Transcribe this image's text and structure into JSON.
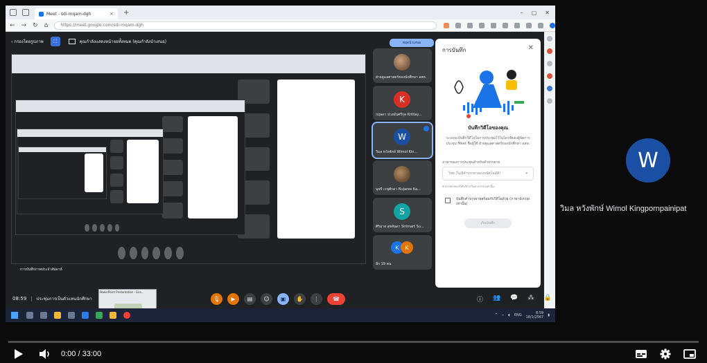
{
  "browser": {
    "tab_title": "Meet - sdi-mqam-dgh",
    "tab_close": "×",
    "new_tab": "+",
    "url": "https://meet.google.com/sdi-mqam-dgh",
    "minimize": "–",
    "maximize": "▢",
    "close": "✕"
  },
  "meet": {
    "back_label": "‹  กรองโดยรูปภาพ",
    "presenting_text": "คุณกำลังแสดงหน้าจอทั้งหมด (คุณกำลังนำเสนอ)",
    "stop_label": "หยุดนำเสนอ",
    "clock": "08:59",
    "separator": "|",
    "meeting_title": "ประชุมการเป็นตัวแทนนักศึกษา",
    "recording_chip": "การบันทึกภาพประจำสัปดาห์",
    "pp_label": "PowerPoint Presentation - Eva...",
    "participants": [
      {
        "initial": "",
        "name": "ฝ่ายดูแลศาสตร์ของนักศึกษา อสท.",
        "color": "#5f6368"
      },
      {
        "initial": "K",
        "name": "กฤษดา ปวงมั่นศรีกุล Krittay...",
        "color": "#d93025"
      },
      {
        "initial": "W",
        "name": "วิมล หวังพักษ์ Wimol Kin...",
        "color": "#1a4fa3"
      },
      {
        "initial": "",
        "name": "นุชรี เรชุศักดา Nujaree Ka...",
        "color": "#5f6368"
      },
      {
        "initial": "S",
        "name": "ศิริมาส สุขจันดา Sirimart Su...",
        "color": "#12a4a4"
      }
    ],
    "others_label": "อีก 19 คน",
    "others_initials": [
      "K",
      "K"
    ],
    "record_panel": {
      "title": "การบันทึก",
      "close": "✕",
      "heading": "บันทึกวิดีโอของคุณ",
      "body": "ระบบจะบันทึกวิดีโอในการประชุมไว้ในไดรฟ์ของผู้จัดการประชุม Meet ชื่อผู้ใช้ ฝ่ายดูแลศาสตร์ของนักศึกษา อสท.",
      "select_label": "ภาษาของการประชุมสำหรับคำบรรยาย",
      "select_value": "ไทย (ไม่มีคำบรรยายแบบอัตโนมัติ)",
      "hint": "คำบรรยายจะมีให้บริการในบางภาษาเท่านั้น",
      "checkbox_text": "บันทึกคำบรรยายพร้อมกับวิดีโอด้วย (ภาษาอังกฤษเท่านั้น)",
      "start_label": "เริ่มบันทึก"
    },
    "right_ctrl_icons": [
      "info-icon",
      "people-icon",
      "chat-icon",
      "activities-icon",
      "lock-icon"
    ],
    "right_ctrl_glyphs": [
      "ⓘ",
      "👥",
      "💬",
      "⁂",
      "🔒"
    ]
  },
  "taskbar": {
    "lang": "ENG",
    "time": "8:59",
    "date": "18/1/2567"
  },
  "participant_main": {
    "initial": "W",
    "name": "วิมล หวังพักษ์ Wimol Kingpornpainipat",
    "color": "#1a4fa3"
  },
  "player": {
    "time_text": "0:00 / 33:00",
    "progress": 0
  }
}
